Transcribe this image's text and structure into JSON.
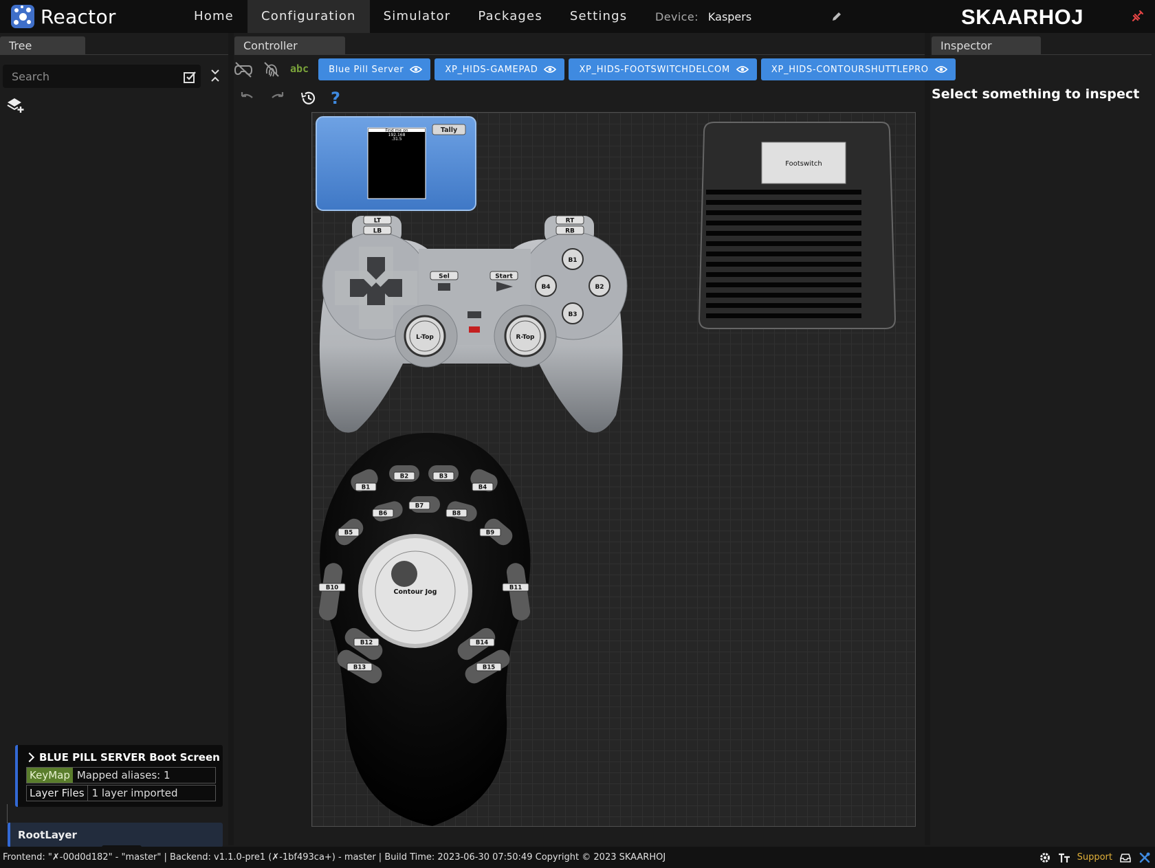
{
  "app": {
    "title": "Reactor"
  },
  "nav": {
    "items": [
      "Home",
      "Configuration",
      "Simulator",
      "Packages",
      "Settings"
    ],
    "active": "Configuration"
  },
  "device": {
    "label": "Device:",
    "value": "Kaspers"
  },
  "brand": {
    "name": "SKAARHOJ"
  },
  "panels": {
    "tree": "Tree",
    "controller": "Controller",
    "inspector": "Inspector"
  },
  "tree": {
    "search_placeholder": "Search",
    "card": {
      "title": "BLUE PILL SERVER Boot Screen",
      "keymap_tag": "KeyMap",
      "keymap_value": "Mapped aliases: 1",
      "files_tag": "Layer Files",
      "files_value": "1 layer imported"
    },
    "root_layer": "RootLayer"
  },
  "controller": {
    "toolbar_abc": "abc",
    "help": "?",
    "devices": [
      "Blue Pill Server",
      "XP_HIDS-GAMEPAD",
      "XP_HIDS-FOOTSWITCHDELCOM",
      "XP_HIDS-CONTOURSHUTTLEPRO"
    ]
  },
  "canvas": {
    "bluepill": {
      "screen_line1": "Find me on",
      "screen_line2": "192.168",
      "screen_line3": ".31.5",
      "tally": "Tally"
    },
    "gamepad": {
      "lt": "LT",
      "lb": "LB",
      "rt": "RT",
      "rb": "RB",
      "sel": "Sel",
      "start": "Start",
      "b1": "B1",
      "b2": "B2",
      "b3": "B3",
      "b4": "B4",
      "ltop": "L-Top",
      "rtop": "R-Top"
    },
    "footswitch": {
      "label": "Footswitch"
    },
    "contour": {
      "jog": "Contour Jog",
      "buttons": [
        "B1",
        "B2",
        "B3",
        "B4",
        "B5",
        "B6",
        "B7",
        "B8",
        "B9",
        "B10",
        "B11",
        "B12",
        "B13",
        "B14",
        "B15"
      ]
    }
  },
  "inspector": {
    "message": "Select something to inspect"
  },
  "footer": {
    "text": "Frontend: \"✗-00d0d182\" - \"master\" | Backend: v1.1.0-pre1 (✗-1bf493ca+) - master | Build Time: 2023-06-30 07:50:49   Copyright © 2023 SKAARHOJ",
    "support": "Support"
  },
  "colors": {
    "accent": "#3f8ae0",
    "keymap": "#5a7d2c",
    "support": "#e2b13a",
    "bluepill": "#4a8ad6"
  }
}
